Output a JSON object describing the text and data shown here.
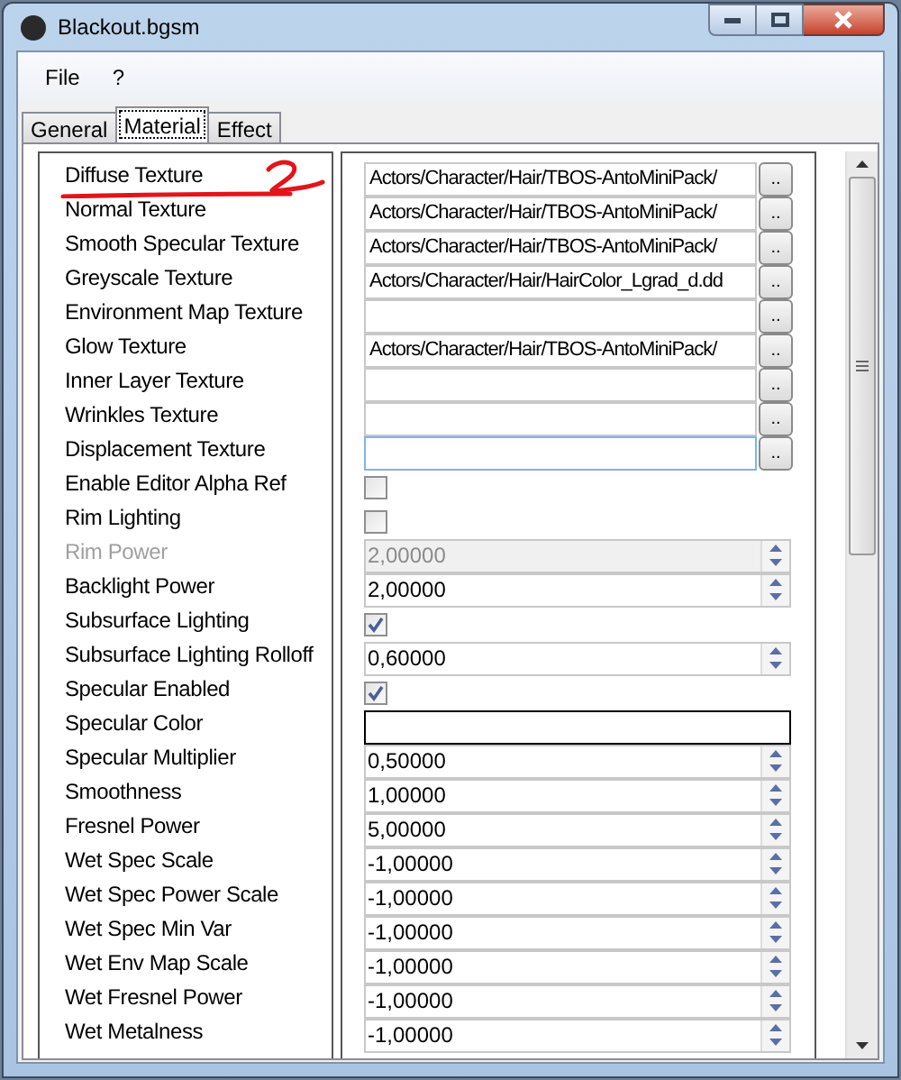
{
  "window": {
    "title": "Blackout.bgsm"
  },
  "menu": [
    "File",
    "?"
  ],
  "tabs": [
    {
      "label": "General",
      "selected": false
    },
    {
      "label": "Material",
      "selected": true
    },
    {
      "label": "Effect",
      "selected": false
    }
  ],
  "properties": [
    {
      "label": "Diffuse Texture",
      "kind": "file",
      "value": "Actors/Character/Hair/TBOS-AntoMiniPack/",
      "button": ".."
    },
    {
      "label": "Normal Texture",
      "kind": "file",
      "value": "Actors/Character/Hair/TBOS-AntoMiniPack/",
      "button": ".."
    },
    {
      "label": "Smooth Specular Texture",
      "kind": "file",
      "value": "Actors/Character/Hair/TBOS-AntoMiniPack/",
      "button": ".."
    },
    {
      "label": "Greyscale Texture",
      "kind": "file",
      "value": "Actors/Character/Hair/HairColor_Lgrad_d.dd",
      "button": ".."
    },
    {
      "label": "Environment Map Texture",
      "kind": "file",
      "button": ".."
    },
    {
      "label": "Glow Texture",
      "kind": "file",
      "value": "Actors/Character/Hair/TBOS-AntoMiniPack/",
      "button": ".."
    },
    {
      "label": "Inner Layer Texture",
      "kind": "file",
      "button": ".."
    },
    {
      "label": "Wrinkles Texture",
      "kind": "file",
      "button": ".."
    },
    {
      "label": "Displacement Texture",
      "kind": "file",
      "button": "..",
      "focused": true
    },
    {
      "label": "Enable Editor Alpha Ref",
      "kind": "checkbox",
      "checked": false
    },
    {
      "label": "Rim Lighting",
      "kind": "checkbox",
      "checked": false
    },
    {
      "label": "Rim Power",
      "kind": "spin",
      "value": "2,00000",
      "disabled": true
    },
    {
      "label": "Backlight Power",
      "kind": "spin",
      "value": "2,00000",
      "disabled": false
    },
    {
      "label": "Subsurface Lighting",
      "kind": "checkbox",
      "checked": true
    },
    {
      "label": "Subsurface Lighting Rolloff",
      "kind": "spin",
      "value": "0,60000",
      "disabled": false
    },
    {
      "label": "Specular Enabled",
      "kind": "checkbox",
      "checked": true
    },
    {
      "label": "Specular Color",
      "kind": "color",
      "color": "#ffffff"
    },
    {
      "label": "Specular Multiplier",
      "kind": "spin",
      "value": "0,50000",
      "disabled": false
    },
    {
      "label": "Smoothness",
      "kind": "spin",
      "value": "1,00000",
      "disabled": false
    },
    {
      "label": "Fresnel Power",
      "kind": "spin",
      "value": "5,00000",
      "disabled": false
    },
    {
      "label": "Wet Spec Scale",
      "kind": "spin",
      "value": "-1,00000",
      "disabled": false
    },
    {
      "label": "Wet Spec Power Scale",
      "kind": "spin",
      "value": "-1,00000",
      "disabled": false
    },
    {
      "label": "Wet Spec Min Var",
      "kind": "spin",
      "value": "-1,00000",
      "disabled": false
    },
    {
      "label": "Wet Env Map Scale",
      "kind": "spin",
      "value": "-1,00000",
      "disabled": false
    },
    {
      "label": "Wet Fresnel Power",
      "kind": "spin",
      "value": "-1,00000",
      "disabled": false
    },
    {
      "label": "Wet Metalness",
      "kind": "spin",
      "value": "-1,00000",
      "disabled": false
    }
  ]
}
